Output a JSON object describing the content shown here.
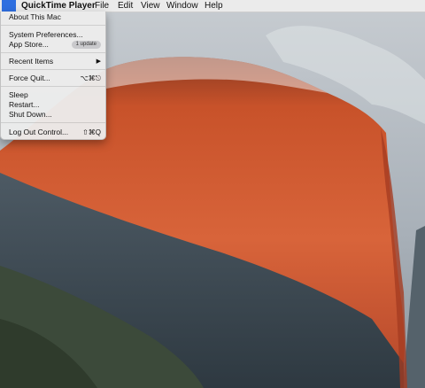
{
  "menubar": {
    "apple_glyph": "",
    "app_name": "QuickTime Player",
    "menus": [
      "File",
      "Edit",
      "View",
      "Window",
      "Help"
    ]
  },
  "apple_menu": {
    "about": "About This Mac",
    "system_preferences": "System Preferences...",
    "app_store": "App Store...",
    "app_store_badge": "1 update",
    "recent_items": "Recent Items",
    "recent_items_arrow": "▶",
    "force_quit": "Force Quit...",
    "force_quit_shortcut": "⌥⌘⎋",
    "sleep": "Sleep",
    "restart": "Restart...",
    "shut_down": "Shut Down...",
    "log_out": "Log Out Control...",
    "log_out_shortcut": "⇧⌘Q"
  },
  "colors": {
    "accent": "#2f6fe0",
    "menu_bg": "#ececec"
  },
  "icons": {
    "apple_menu": "apple-logo-icon"
  }
}
